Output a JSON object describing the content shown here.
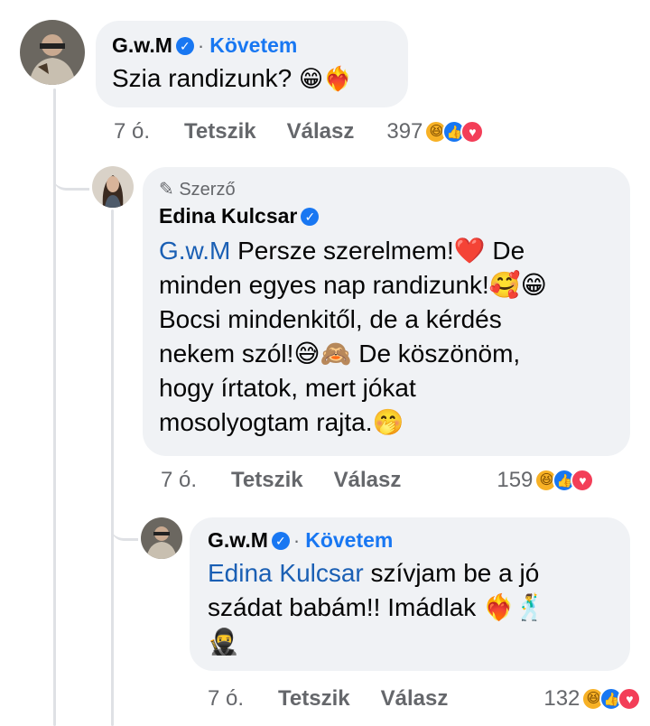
{
  "comments": [
    {
      "author": "G.w.M",
      "verified_icon": "check-icon",
      "separator": "·",
      "follow_label": "Követem",
      "text": "Szia randizunk?",
      "emojis": "😁❤️‍🔥",
      "time": "7 ó.",
      "like_label": "Tetszik",
      "reply_label": "Válasz",
      "reaction_count": "397"
    },
    {
      "author_tag": "Szerző",
      "author": "Edina Kulcsar",
      "verified_icon": "check-icon",
      "mention": "G.w.M",
      "lines": [
        "Persze szerelmem!❤️ De",
        "minden egyes nap randizunk!🥰😁",
        "Bocsi mindenkitől, de a kérdés",
        "nekem szól!😅🙈 De köszönöm,",
        "hogy írtatok, mert jókat",
        "mosolyogtam rajta.🤭"
      ],
      "time": "7 ó.",
      "like_label": "Tetszik",
      "reply_label": "Válasz",
      "reaction_count": "159"
    },
    {
      "author": "G.w.M",
      "verified_icon": "check-icon",
      "separator": "·",
      "follow_label": "Követem",
      "mention": "Edina Kulcsar",
      "line1": "szívjam be a jó",
      "line2": "szádat babám!! Imádlak ❤️‍🔥🕺",
      "line3": "🥷",
      "time": "7 ó.",
      "like_label": "Tetszik",
      "reply_label": "Válasz",
      "reaction_count": "132"
    }
  ],
  "reaction_icons": [
    "haha-icon",
    "like-icon",
    "love-icon"
  ],
  "colors": {
    "bubble": "#f0f2f5",
    "accent": "#1877f2",
    "muted": "#65676b"
  }
}
